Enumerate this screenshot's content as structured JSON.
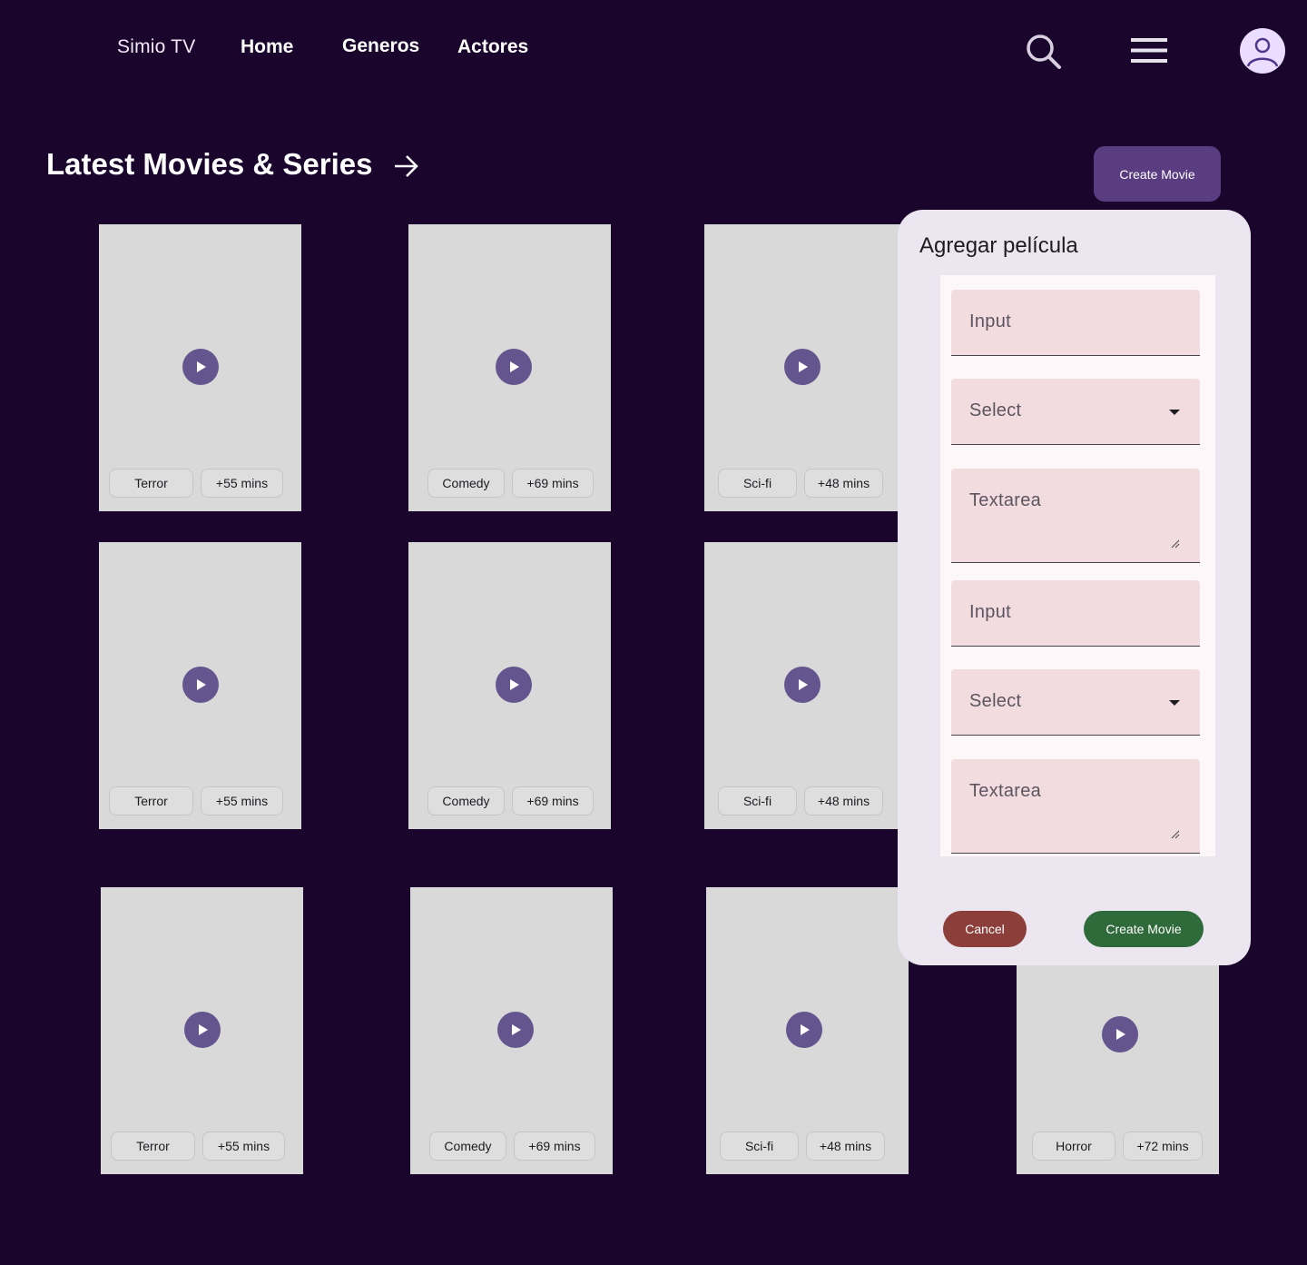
{
  "header": {
    "brand": "Simio TV",
    "nav": [
      "Home",
      "Generos",
      "Actores"
    ],
    "icons": [
      "search-icon",
      "menu-icon",
      "account-icon"
    ]
  },
  "section": {
    "title": "Latest Movies & Series",
    "arrow_icon": "arrow-right-icon",
    "create_label": "Create Movie"
  },
  "cards": [
    {
      "genre": "Terror",
      "duration": "+55 mins"
    },
    {
      "genre": "Comedy",
      "duration": "+69 mins"
    },
    {
      "genre": "Sci-fi",
      "duration": "+48 mins"
    },
    {
      "genre": "Terror",
      "duration": "+55 mins"
    },
    {
      "genre": "Comedy",
      "duration": "+69 mins"
    },
    {
      "genre": "Sci-fi",
      "duration": "+48 mins"
    },
    {
      "genre": "Terror",
      "duration": "+55 mins"
    },
    {
      "genre": "Comedy",
      "duration": "+69 mins"
    },
    {
      "genre": "Sci-fi",
      "duration": "+48 mins"
    },
    {
      "genre": "Horror",
      "duration": "+72 mins"
    }
  ],
  "dialog": {
    "title": "Agregar película",
    "fields": [
      {
        "type": "input",
        "label": "Input"
      },
      {
        "type": "select",
        "label": "Select"
      },
      {
        "type": "textarea",
        "label": "Textarea"
      },
      {
        "type": "input",
        "label": "Input"
      },
      {
        "type": "select",
        "label": "Select"
      },
      {
        "type": "textarea",
        "label": "Textarea"
      }
    ],
    "cancel_label": "Cancel",
    "create_label": "Create Movie"
  },
  "colors": {
    "background": "#1a052c",
    "primary": "#65558f",
    "dialog": "#ece6f0",
    "cancel": "#8c3f3a",
    "create": "#2e6a3a"
  }
}
